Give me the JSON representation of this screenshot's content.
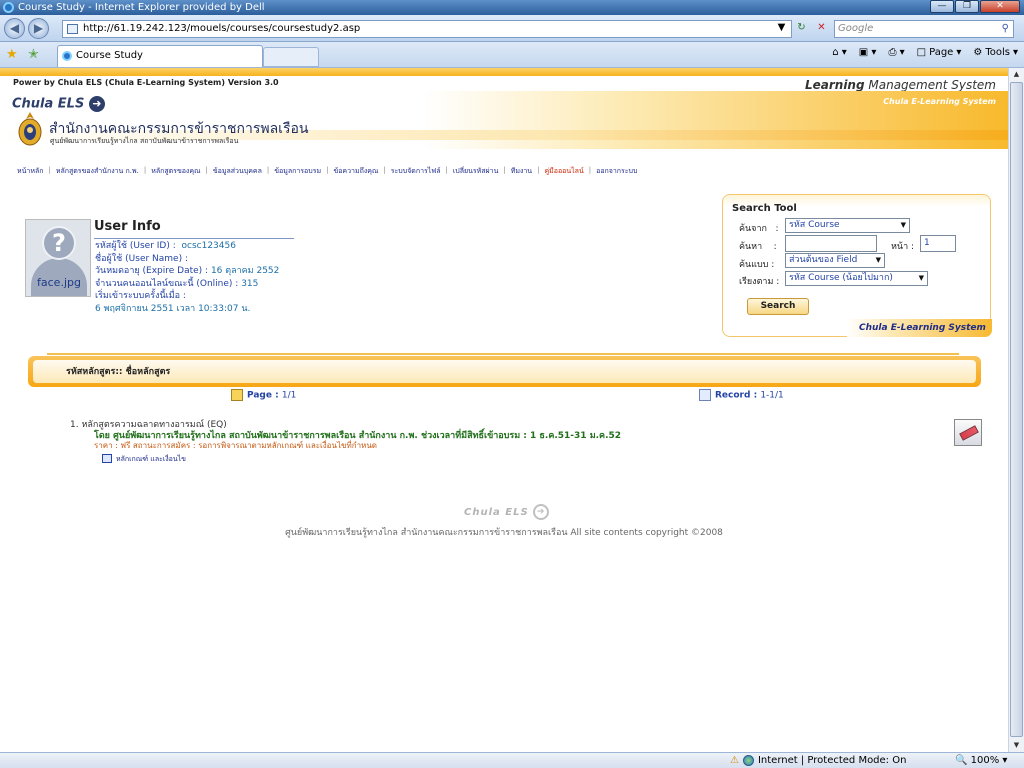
{
  "browser": {
    "window_title": "Course Study - Internet Explorer provided by Dell",
    "url": "http://61.19.242.123/mouels/courses/coursestudy2.asp",
    "search_placeholder": "Google",
    "tab_title": "Course Study",
    "cmd_page": "Page",
    "cmd_tools": "Tools",
    "status_zone": "Internet | Protected Mode: On",
    "zoom": "100%"
  },
  "header": {
    "power_text": "Power by Chula ELS (Chula E-Learning System) Version 3.0",
    "lms_bold": "Learning",
    "lms_rest": " Management System",
    "brand": "Chula ELS",
    "system_tag": "Chula E-Learning System",
    "org_name": "สำนักงานคณะกรรมการข้าราชการพลเรือน",
    "org_sub": "ศูนย์พัฒนาการเรียนรู้ทางไกล สถาบันพัฒนาข้าราชการพลเรือน"
  },
  "nav": [
    "หน้าหลัก",
    "หลักสูตรของสำนักงาน ก.พ.",
    "หลักสูตรของคุณ",
    "ข้อมูลส่วนบุคคล",
    "ข้อมูลการอบรม",
    "ข้อความถึงคุณ",
    "ระบบจัดการไฟล์",
    "เปลี่ยนรหัสผ่าน",
    "ทีมงาน",
    "คู่มือออนไลน์",
    "ออกจากระบบ"
  ],
  "user_info": {
    "title": "User Info",
    "photo_caption": "face.jpg",
    "user_id_label": "รหัสผู้ใช้ (User ID) :",
    "user_id_value": "ocsc123456",
    "user_name_label": "ชื่อผู้ใช้ (User Name) :",
    "expire_label": "วันหมดอายุ (Expire Date) :",
    "expire_value": "16 ตุลาคม 2552",
    "online_label": "จำนวนคนออนไลน์ขณะนี้ (Online) :",
    "online_value": "315",
    "first_login_label": "เริ่มเข้าระบบครั้งนี้เมื่อ :",
    "first_login_value": "6 พฤศจิกายน 2551 เวลา 10:33:07 น."
  },
  "search_tool": {
    "title": "Search Tool",
    "from_label": "ค้นจาก",
    "from_value": "รหัส Course",
    "find_label": "ค้นหา",
    "find_value": "",
    "page_label": "หน้า :",
    "page_value": "1",
    "mode_label": "ค้นแบบ",
    "mode_value": "ส่วนต้นของ Field",
    "sort_label": "เรียงตาม",
    "sort_value": "รหัส Course (น้อยไปมาก)",
    "button": "Search",
    "footer": "Chula E-Learning System"
  },
  "course_list": {
    "title": "รหัสหลักสูตร:: ชื่อหลักสูตร",
    "page_label": "Page :",
    "page_value": "1/1",
    "record_label": "Record :",
    "record_value": "1-1/1",
    "items": [
      {
        "title": "1. หลักสูตรความฉลาดทางอารมณ์ (EQ)",
        "by": "โดย ศูนย์พัฒนาการเรียนรู้ทางไกล สถาบันพัฒนาข้าราชการพลเรือน สำนักงาน ก.พ.   ช่วงเวลาที่มีสิทธิ์เข้าอบรม : 1 ธ.ค.51-31 ม.ค.52",
        "price": "ราคา : ฟรี   สถานะการสมัคร : รอการพิจารณาตามหลักเกณฑ์ และเงื่อนไขที่กำหนด",
        "sub": "หลักเกณฑ์ และเงื่อนไข"
      }
    ]
  },
  "footer": {
    "logo": "Chula ELS",
    "copyright": "ศูนย์พัฒนาการเรียนรู้ทางไกล สำนักงานคณะกรรมการข้าราชการพลเรือน All site contents copyright ©2008"
  }
}
